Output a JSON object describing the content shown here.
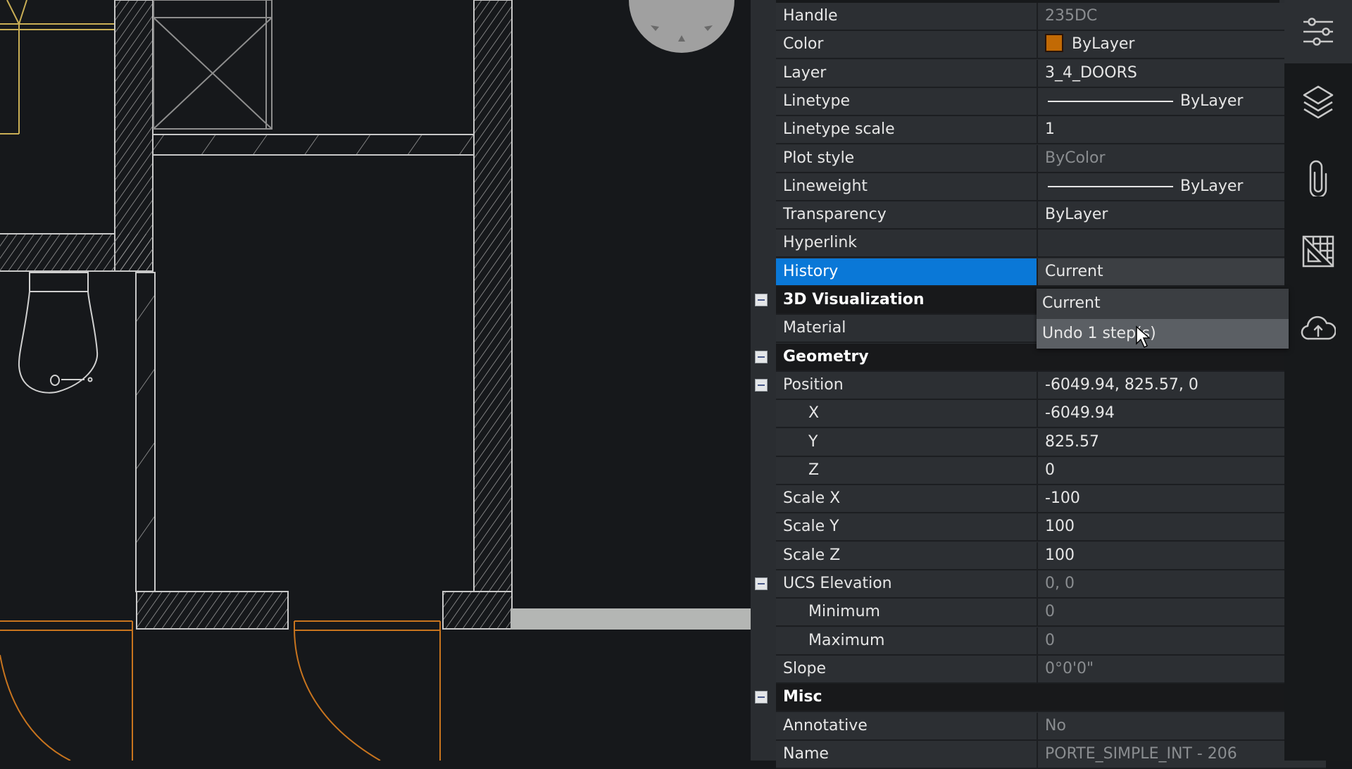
{
  "canvas": {
    "name": "cad-drawing-viewport",
    "colors": {
      "background": "#16181b",
      "wall": "#c8c8c8",
      "door": "#c8741e",
      "fixture_yellow": "#c9ae55",
      "grip": "#b4b6b4"
    }
  },
  "properties": {
    "rows": [
      {
        "label": "Handle",
        "value": "235DC",
        "dim": true
      },
      {
        "label": "Color",
        "value": "ByLayer",
        "swatch": "#c26a05"
      },
      {
        "label": "Layer",
        "value": "3_4_DOORS"
      },
      {
        "label": "Linetype",
        "value": "ByLayer",
        "line_sample": true
      },
      {
        "label": "Linetype scale",
        "value": "1"
      },
      {
        "label": "Plot style",
        "value": "ByColor",
        "dim": true
      },
      {
        "label": "Lineweight",
        "value": "ByLayer",
        "line_sample": true
      },
      {
        "label": "Transparency",
        "value": "ByLayer"
      },
      {
        "label": "Hyperlink",
        "value": ""
      },
      {
        "label": "History",
        "value": "Current",
        "selected": true,
        "dropdown": true
      },
      {
        "label": "3D Visualization",
        "section": true
      },
      {
        "label": "Material",
        "value": ""
      },
      {
        "label": "Geometry",
        "section": true
      },
      {
        "label": "Position",
        "value": "-6049.94, 825.57, 0",
        "group": true
      },
      {
        "label": "X",
        "value": "-6049.94",
        "indent": true
      },
      {
        "label": "Y",
        "value": "825.57",
        "indent": true
      },
      {
        "label": "Z",
        "value": "0",
        "indent": true
      },
      {
        "label": "Scale X",
        "value": "-100"
      },
      {
        "label": "Scale Y",
        "value": "100"
      },
      {
        "label": "Scale Z",
        "value": "100"
      },
      {
        "label": "UCS Elevation",
        "value": "0, 0",
        "dim": true,
        "group": true
      },
      {
        "label": "Minimum",
        "value": "0",
        "dim": true,
        "indent": true
      },
      {
        "label": "Maximum",
        "value": "0",
        "dim": true,
        "indent": true
      },
      {
        "label": "Slope",
        "value": "0°0'0\"",
        "dim": true
      },
      {
        "label": "Misc",
        "section": true
      },
      {
        "label": "Annotative",
        "value": "No",
        "dim": true
      },
      {
        "label": "Name",
        "value": "PORTE_SIMPLE_INT - 206",
        "dim": true
      }
    ],
    "colors": {
      "selected_label_bg": "#0a78d7",
      "panel_bg": "#2c2f33",
      "section_bg": "#18191b"
    }
  },
  "history_dropdown": {
    "options": [
      "Current",
      "Undo 1 step(s)"
    ],
    "hovered_index": 1
  },
  "iconbar": {
    "items": [
      {
        "icon": "properties-sliders-icon",
        "active": true
      },
      {
        "icon": "layers-icon"
      },
      {
        "icon": "attachments-paperclip-icon"
      },
      {
        "icon": "drawing-explorer-triangle-ruler-icon"
      },
      {
        "icon": "cloud-upload-icon"
      }
    ]
  }
}
